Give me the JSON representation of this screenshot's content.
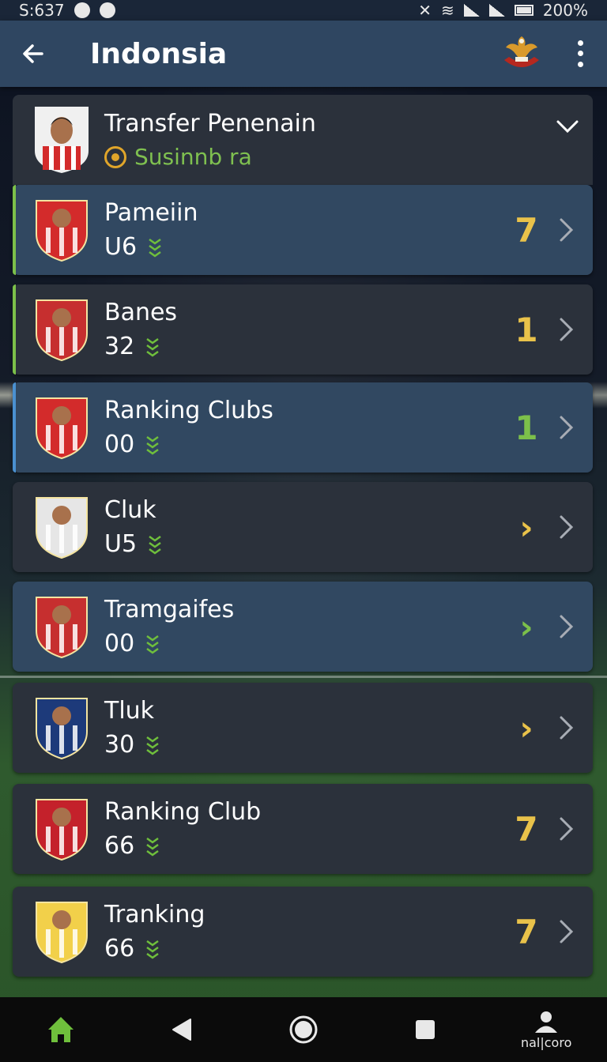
{
  "status_bar": {
    "time": "S:637",
    "battery": "200%"
  },
  "app_bar": {
    "title": "Indonsia"
  },
  "header": {
    "title": "Transfer Penenain",
    "subtitle": "Susinnb ra"
  },
  "rows": [
    {
      "name": "Pameiin",
      "value": "U6",
      "rank": "7",
      "rank_color": "#e9c24a",
      "style": "blue",
      "edge": "#7cc04a"
    },
    {
      "name": "Banes",
      "value": "32",
      "rank": "1",
      "rank_color": "#e9c24a",
      "style": "dark",
      "edge": "#7cc04a"
    },
    {
      "name": "Ranking Clubs",
      "value": "00",
      "rank": "1",
      "rank_color": "#7cc04a",
      "style": "blue",
      "edge": "#4a90d0"
    },
    {
      "name": "Cluk",
      "value": "U5",
      "rank": "›",
      "rank_color": "#e9c24a",
      "style": "dark",
      "edge": ""
    },
    {
      "name": "Tramgaifes",
      "value": "00",
      "rank": "›",
      "rank_color": "#7cc04a",
      "style": "blue",
      "edge": ""
    },
    {
      "name": "Tluk",
      "value": "30",
      "rank": "›",
      "rank_color": "#e9c24a",
      "style": "dark",
      "edge": ""
    },
    {
      "name": "Ranking Club",
      "value": "66",
      "rank": "7",
      "rank_color": "#e9c24a",
      "style": "dark",
      "edge": ""
    },
    {
      "name": "Tranking",
      "value": "66",
      "rank": "7",
      "rank_color": "#e9c24a",
      "style": "dark",
      "edge": ""
    }
  ],
  "bottom_nav": {
    "profile_label": "nal|coro"
  },
  "colors": {
    "app_bar": "#2f4661",
    "card_dark": "#2b313b",
    "card_blue": "#314861",
    "accent_green": "#7cc04a",
    "accent_gold": "#e9c24a"
  }
}
